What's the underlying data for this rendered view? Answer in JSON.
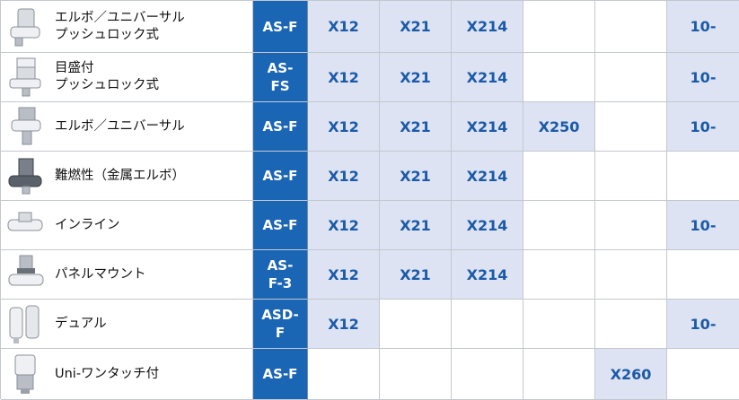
{
  "rows": [
    {
      "name": "エルボ／ユニバーサル\nプッシュロック式",
      "series": "AS-F",
      "cells": [
        "X12",
        "X21",
        "X214",
        "",
        "",
        "10-"
      ],
      "icon": "elbow-universal-push-lock-fitting-icon"
    },
    {
      "name": "目盛付\nプッシュロック式",
      "series": "AS-\nFS",
      "cells": [
        "X12",
        "X21",
        "X214",
        "",
        "",
        "10-"
      ],
      "icon": "scaled-push-lock-fitting-icon"
    },
    {
      "name": "エルボ／ユニバーサル",
      "series": "AS-F",
      "cells": [
        "X12",
        "X21",
        "X214",
        "X250",
        "",
        "10-"
      ],
      "icon": "elbow-universal-fitting-icon"
    },
    {
      "name": "難燃性（金属エルボ）",
      "series": "AS-F",
      "cells": [
        "X12",
        "X21",
        "X214",
        "",
        "",
        ""
      ],
      "icon": "flame-resistant-metal-elbow-icon"
    },
    {
      "name": "インライン",
      "series": "AS-F",
      "cells": [
        "X12",
        "X21",
        "X214",
        "",
        "",
        "10-"
      ],
      "icon": "inline-fitting-icon"
    },
    {
      "name": "パネルマウント",
      "series": "AS-\nF-3",
      "cells": [
        "X12",
        "X21",
        "X214",
        "",
        "",
        ""
      ],
      "icon": "panel-mount-fitting-icon"
    },
    {
      "name": "デュアル",
      "series": "ASD-\nF",
      "cells": [
        "X12",
        "",
        "",
        "",
        "",
        "10-"
      ],
      "icon": "dual-fitting-icon"
    },
    {
      "name": "Uni-ワンタッチ付",
      "series": "AS-F",
      "cells": [
        "",
        "",
        "",
        "",
        "X260",
        ""
      ],
      "icon": "uni-one-touch-fitting-icon"
    }
  ],
  "colors": {
    "series_bg": "#1b65b5",
    "highlight_bg": "#dde3f2",
    "code_text": "#1a5aa8",
    "grid": "#c4c8d0"
  }
}
